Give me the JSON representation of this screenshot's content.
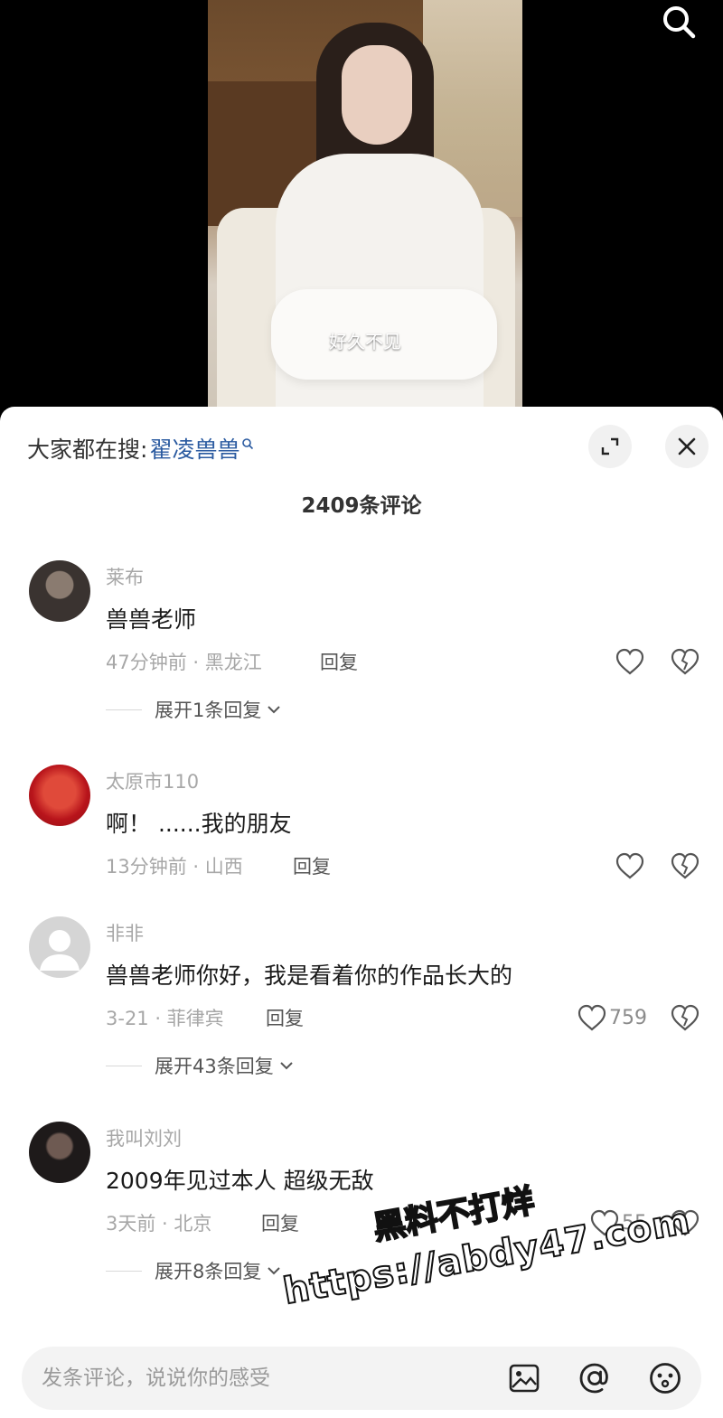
{
  "video": {
    "caption": "好久不见",
    "search_icon": "search-icon"
  },
  "panel": {
    "hot_search_prefix": "大家都在搜:",
    "hot_search_term": "翟凌兽兽",
    "comment_count": "2409条评论"
  },
  "comments": [
    {
      "user": "莱布",
      "text": "兽兽老师",
      "time_location": "47分钟前 · 黑龙江",
      "reply_label": "回复",
      "likes": "",
      "expand_label": "展开1条回复"
    },
    {
      "user": "太原市110",
      "text": "啊！ ......我的朋友",
      "time_location": "13分钟前 · 山西",
      "reply_label": "回复",
      "likes": ""
    },
    {
      "user": "非非",
      "text": "兽兽老师你好，我是看着你的作品长大的",
      "time_location": "3-21 · 菲律宾",
      "reply_label": "回复",
      "likes": "759",
      "expand_label": "展开43条回复"
    },
    {
      "user": "我叫刘刘",
      "text": "2009年见过本人 超级无敌",
      "time_location": "3天前 · 北京",
      "reply_label": "回复",
      "likes": "55",
      "expand_label": "展开8条回复"
    }
  ],
  "input": {
    "placeholder": "发条评论，说说你的感受",
    "icons": [
      "image-icon",
      "at-icon",
      "emoji-icon"
    ]
  },
  "watermark": {
    "line1": "黑料不打烊",
    "line2": "https://abdy47.com"
  },
  "colors": {
    "accent_link": "#2a5aa0",
    "muted_text": "#a7a7a7",
    "background": "#ffffff"
  }
}
